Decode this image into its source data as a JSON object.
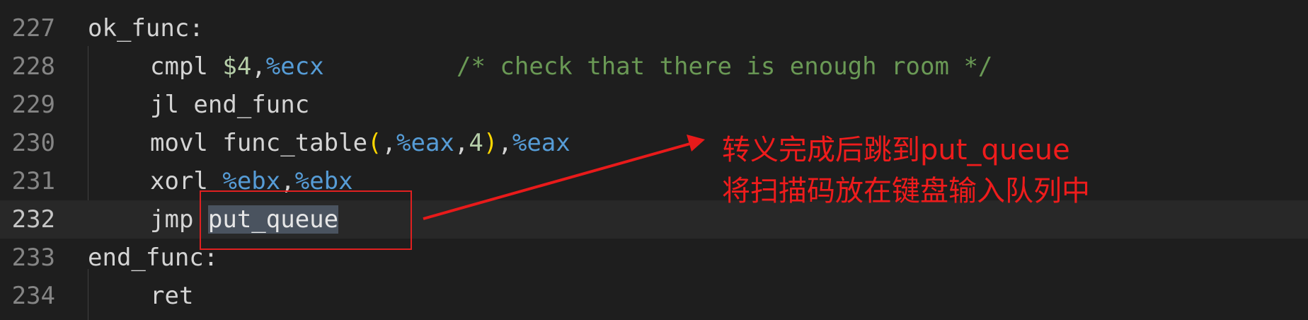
{
  "editor": {
    "lines": [
      {
        "number": "227",
        "text": "ok_func:"
      },
      {
        "number": "228",
        "text": "cmpl $4,%ecx        /* check that there is enough room */"
      },
      {
        "number": "229",
        "text": "jl end_func"
      },
      {
        "number": "230",
        "text": "movl func_table(,%eax,4),%eax"
      },
      {
        "number": "231",
        "text": "xorl %ebx,%ebx"
      },
      {
        "number": "232",
        "text": "jmp put_queue",
        "current": true,
        "selected_token": "put_queue"
      },
      {
        "number": "233",
        "text": "end_func:"
      },
      {
        "number": "234",
        "text": "ret"
      }
    ],
    "tokens": {
      "l227_label": "ok_func:",
      "l228_op": "cmpl ",
      "l228_imm": "$4",
      "l228_comma": ",",
      "l228_reg": "%ecx",
      "l228_comment": "/* check that there is enough room */",
      "l229_code": "jl end_func",
      "l230_op": "movl func_table",
      "l230_paren_open": "(",
      "l230_comma1": ",",
      "l230_reg1": "%eax",
      "l230_comma2": ",",
      "l230_scale": "4",
      "l230_paren_close": ")",
      "l230_comma3": ",",
      "l230_reg2": "%eax",
      "l231_op": "xorl ",
      "l231_reg1": "%ebx",
      "l231_comma": ",",
      "l231_reg2": "%ebx",
      "l232_op": "jmp ",
      "l232_target": "put_queue",
      "l233_label": "end_func:",
      "l234_code": "ret"
    }
  },
  "annotation": {
    "line1": "转义完成后跳到put_queue",
    "line2": "将扫描码放在键盘输入队列中",
    "color": "#ef1c1c"
  },
  "colors": {
    "background": "#1e1e1e",
    "current_line": "#282828",
    "register": "#569cd6",
    "number": "#b5cea8",
    "bracket": "#ffd700",
    "comment": "#6a9955",
    "selection": "#4a535f"
  }
}
